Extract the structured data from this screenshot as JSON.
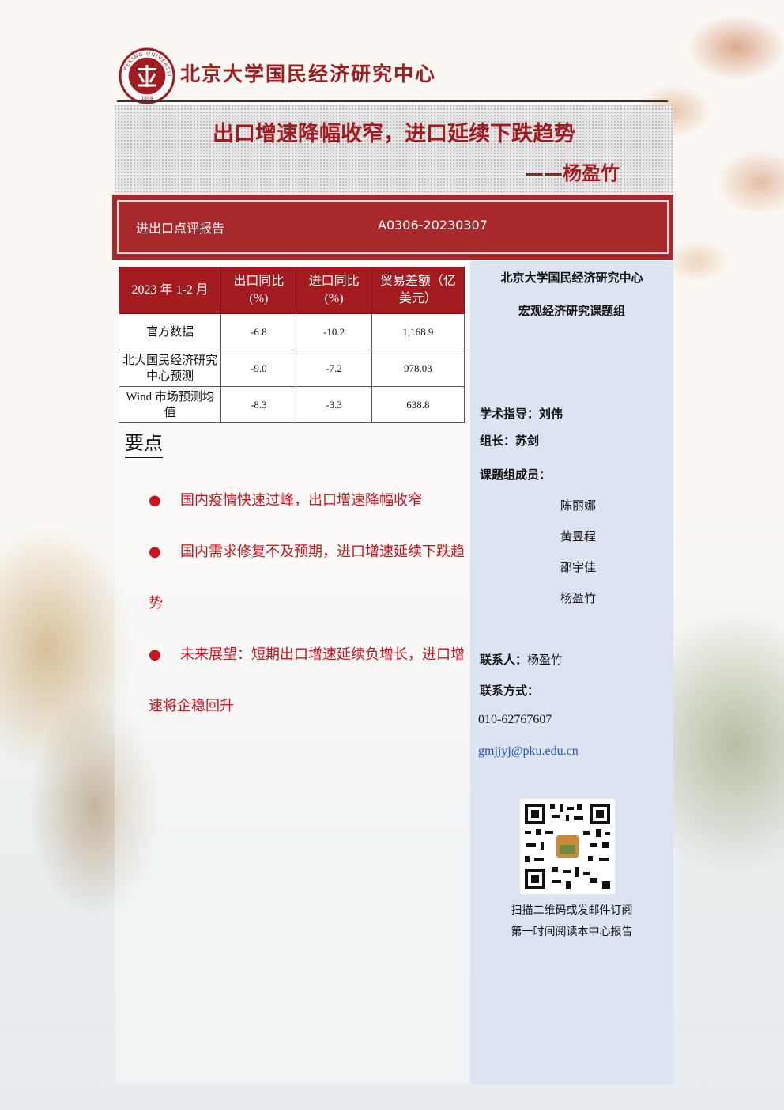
{
  "header": {
    "logo_text": "PEKING UNIVERSITY 1898",
    "org_name": "北京大学国民经济研究中心"
  },
  "title": {
    "main": "出口增速降幅收窄，进口延续下跌趋势",
    "author": "——杨盈竹"
  },
  "banner": {
    "report_type": "进出口点评报告",
    "report_code": "A0306-20230307"
  },
  "table": {
    "headers": [
      "2023 年 1-2 月",
      "出口同比(%)",
      "进口同比(%)",
      "贸易差额（亿美元）"
    ],
    "rows": [
      {
        "label": "官方数据",
        "export": "-6.8",
        "import": "-10.2",
        "balance": "1,168.9"
      },
      {
        "label": "北大国民经济研究中心预测",
        "export": "-9.0",
        "import": "-7.2",
        "balance": "978.03"
      },
      {
        "label": "Wind 市场预测均值",
        "export": "-8.3",
        "import": "-3.3",
        "balance": "638.8"
      }
    ]
  },
  "key_points": {
    "title": "要点",
    "items": [
      "国内疫情快速过峰，出口增速降幅收窄",
      "国内需求修复不及预期，进口增速延续下跌趋势",
      "未来展望：短期出口增速延续负增长，进口增速将企稳回升"
    ]
  },
  "sidebar": {
    "org": "北京大学国民经济研究中心",
    "group": "宏观经济研究课题组",
    "advisor_label": "学术指导：",
    "advisor": "刘伟",
    "leader_label": "组长：",
    "leader": "苏剑",
    "members_label": "课题组成员：",
    "members": [
      "陈丽娜",
      "黄昱程",
      "邵宇佳",
      "杨盈竹"
    ],
    "contact_label": "联系人：",
    "contact": "杨盈竹",
    "method_label": "联系方式：",
    "phone": "010-62767607",
    "email": "gmjjyj@pku.edu.cn",
    "qr_caption_1": "扫描二维码或发邮件订阅",
    "qr_caption_2": "第一时间阅读本中心报告"
  },
  "colors": {
    "brand_red": "#a31a1f",
    "bullet_red": "#d0121b",
    "sidebar_blue": "#dbe4f0"
  }
}
